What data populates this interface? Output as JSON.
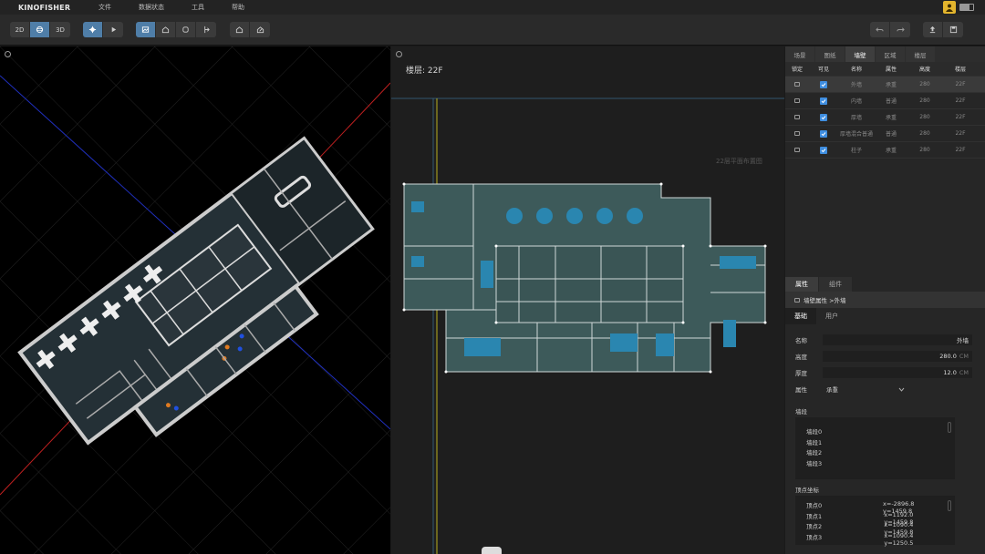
{
  "menubar": {
    "brand": "KINOFISHER",
    "items": [
      "文件",
      "数据状态",
      "工具",
      "帮助"
    ]
  },
  "toolbar": {
    "view_modes": [
      "2D",
      "",
      "3D"
    ],
    "icons": [
      "select-icon",
      "play-icon",
      "image-icon",
      "home-icon",
      "layer-icon",
      "cut-icon",
      "house-icon",
      "house-edit-icon",
      "undo-icon",
      "redo-icon",
      "upload-icon",
      "save-icon"
    ]
  },
  "view2d": {
    "floor_label": "楼层: 22F",
    "caption": "22层平面布置图"
  },
  "panel": {
    "tabs": [
      "场景",
      "图纸",
      "墙壁",
      "区域",
      "楼层"
    ],
    "active_tab": "墙壁",
    "table": {
      "headers": [
        "锁定",
        "可见",
        "名称",
        "属性",
        "高度",
        "楼层"
      ],
      "rows": [
        {
          "name": "外墙",
          "attr": "承重",
          "height": "280",
          "floor": "22F"
        },
        {
          "name": "内墙",
          "attr": "普通",
          "height": "280",
          "floor": "22F"
        },
        {
          "name": "厚墙",
          "attr": "承重",
          "height": "280",
          "floor": "22F"
        },
        {
          "name": "厚墙混合普通",
          "attr": "普通",
          "height": "280",
          "floor": "22F"
        },
        {
          "name": "柱子",
          "attr": "承重",
          "height": "280",
          "floor": "22F"
        }
      ]
    }
  },
  "props": {
    "tabs": [
      "属性",
      "组件"
    ],
    "header": "墙壁属性 >外墙",
    "subtabs": [
      "基础",
      "用户"
    ],
    "fields": {
      "name_label": "名称",
      "name_value": "外墙",
      "height_label": "高度",
      "height_value": "280.0",
      "height_unit": "CM",
      "thick_label": "厚度",
      "thick_value": "12.0",
      "thick_unit": "CM",
      "attr_label": "属性",
      "attr_value": "承重"
    },
    "segments_label": "墙段",
    "segments": [
      "墙段0",
      "墙段1",
      "墙段2",
      "墙段3"
    ],
    "vertices_label": "顶点坐标",
    "vertices": [
      {
        "name": "顶点0",
        "coord": "x=-2896.8  y=1459.8"
      },
      {
        "name": "顶点1",
        "coord": "x=1192.0  y=1459.8"
      },
      {
        "name": "顶点2",
        "coord": "x=1090.4  y=1459.8"
      },
      {
        "name": "顶点3",
        "coord": "x=1090.4  y=1250.5"
      }
    ]
  }
}
